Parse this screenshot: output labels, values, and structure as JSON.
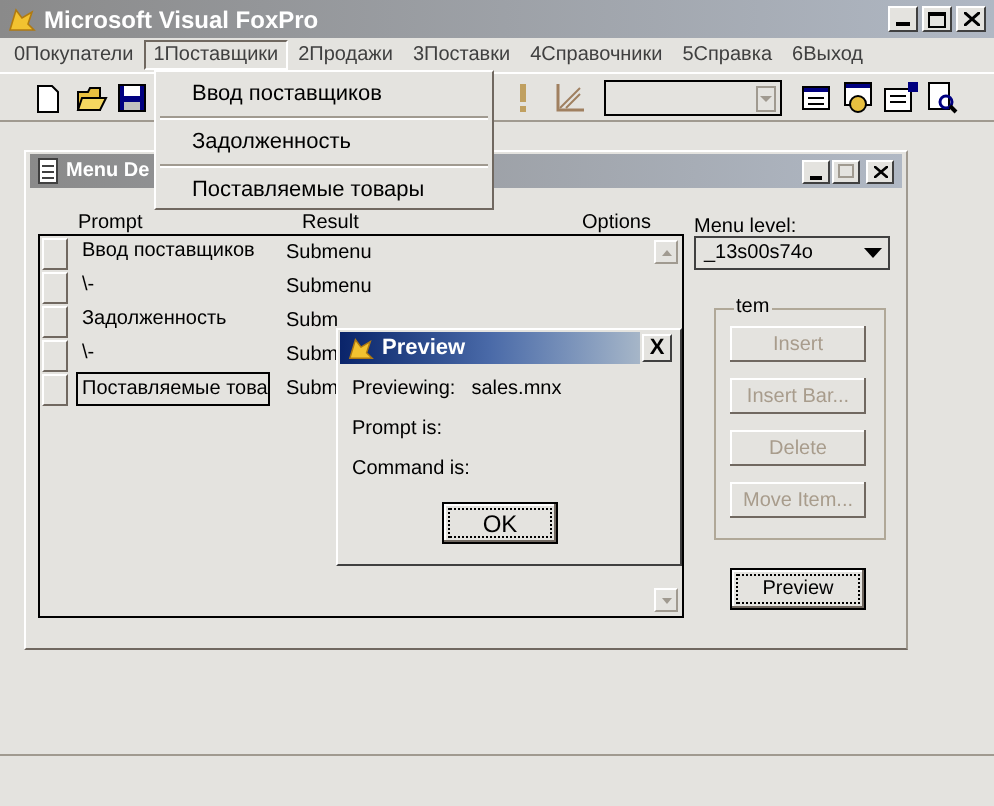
{
  "window": {
    "title": "Microsoft Visual FoxPro"
  },
  "menu_bar": [
    {
      "label": "0Покупатели",
      "selected": false
    },
    {
      "label": "1Поставщики",
      "selected": true
    },
    {
      "label": "2Продажи",
      "selected": false
    },
    {
      "label": "3Поставки",
      "selected": false
    },
    {
      "label": "4Справочники",
      "selected": false
    },
    {
      "label": "5Справка",
      "selected": false
    },
    {
      "label": "6Выход",
      "selected": false
    }
  ],
  "dropdown_menu": [
    "Ввод поставщиков",
    "Задолженность",
    "Поставляемые товары"
  ],
  "menu_designer": {
    "title": "Menu De",
    "columns": [
      "Prompt",
      "Result",
      "Options"
    ],
    "rows": [
      {
        "prompt": "Ввод поставщиков",
        "result": "Submenu",
        "selected": false
      },
      {
        "prompt": "\\-",
        "result": "Submenu",
        "selected": false
      },
      {
        "prompt": "Задолженность",
        "result": "Subm",
        "selected": false
      },
      {
        "prompt": "\\-",
        "result": "Subm",
        "selected": false
      },
      {
        "prompt": "Поставляемые това",
        "result": "Subm",
        "selected": true
      }
    ],
    "menu_level_label": "Menu level:",
    "menu_level": "_13s00s74o",
    "item_group": "tem",
    "item_buttons": [
      {
        "label": "Insert",
        "disabled": true
      },
      {
        "label": "Insert Bar...",
        "disabled": true
      },
      {
        "label": "Delete",
        "disabled": true
      },
      {
        "label": "Move Item...",
        "disabled": true
      }
    ],
    "preview_button": "Preview"
  },
  "preview_dialog": {
    "title": "Preview",
    "close": "X",
    "fields": [
      {
        "label": "Previewing:",
        "value": "sales.mnx"
      },
      {
        "label": "Prompt is:"
      },
      {
        "label": "Command is:"
      }
    ],
    "ok_button": "OK"
  }
}
